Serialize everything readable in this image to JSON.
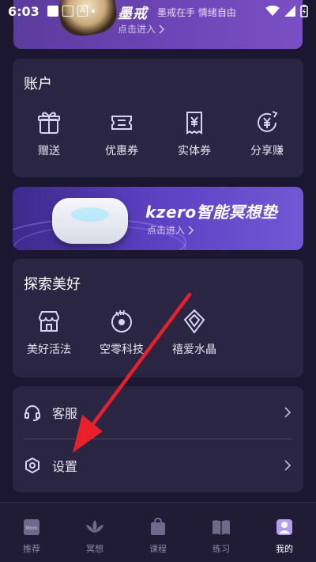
{
  "status_bar": {
    "time": "6:03"
  },
  "top_banner": {
    "brand": "墨戒",
    "slogan": "墨戒在手 情绪自由",
    "enter": "点击进入"
  },
  "account": {
    "title": "账户",
    "items": [
      {
        "label": "赠送",
        "icon": "gift-icon"
      },
      {
        "label": "优惠券",
        "icon": "coupon-icon"
      },
      {
        "label": "实体券",
        "icon": "receipt-icon"
      },
      {
        "label": "分享赚",
        "icon": "share-earn-icon"
      }
    ]
  },
  "kzero_banner": {
    "title": "kzero智能冥想垫",
    "enter": "点击进入"
  },
  "explore": {
    "title": "探索美好",
    "items": [
      {
        "label": "美好活法",
        "icon": "store-icon"
      },
      {
        "label": "空零科技",
        "icon": "dial-icon"
      },
      {
        "label": "禧爱水晶",
        "icon": "crystal-icon"
      }
    ]
  },
  "list": {
    "service": {
      "label": "客服",
      "icon": "headset-icon"
    },
    "settings": {
      "label": "设置",
      "icon": "settings-icon"
    }
  },
  "tabbar": {
    "items": [
      {
        "label": "推荐",
        "icon": "recommend-icon"
      },
      {
        "label": "冥想",
        "icon": "lotus-icon"
      },
      {
        "label": "课程",
        "icon": "bag-icon"
      },
      {
        "label": "练习",
        "icon": "book-icon"
      },
      {
        "label": "我的",
        "icon": "profile-icon",
        "active": true
      }
    ]
  },
  "colors": {
    "background": "#1b1730",
    "card": "#2a2542",
    "annotation_arrow": "#e8202a"
  }
}
